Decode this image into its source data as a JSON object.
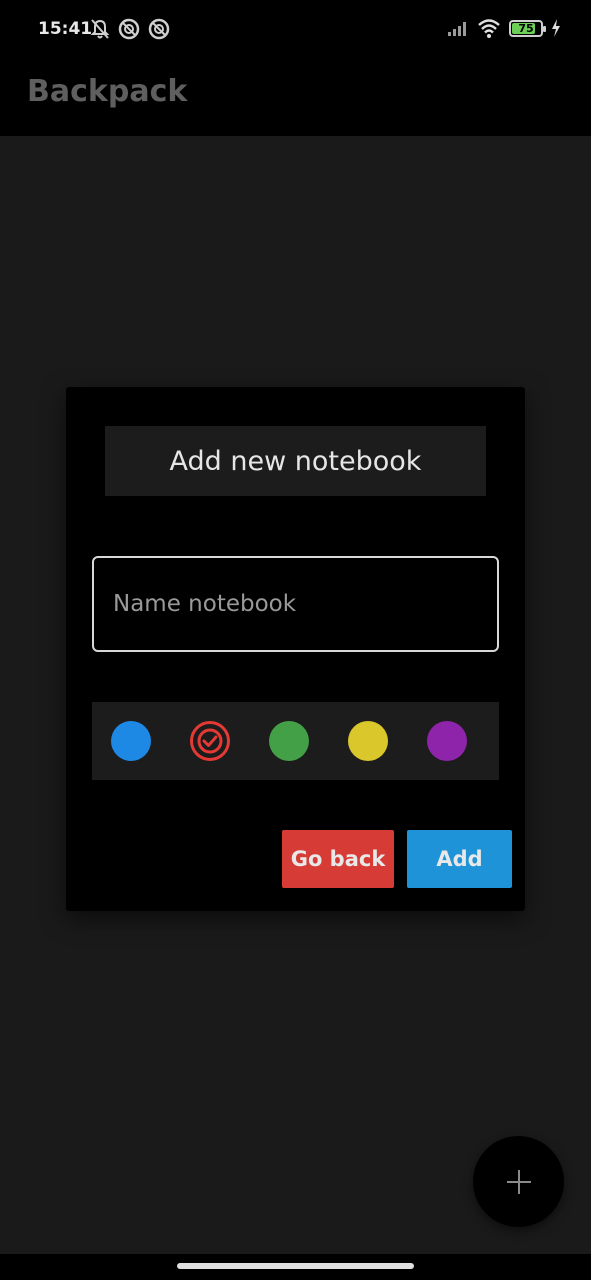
{
  "status_bar": {
    "time": "15:41",
    "battery_level": "75",
    "icons_left": [
      "bell-off-icon",
      "sync-icon",
      "sync-icon"
    ],
    "icons_right": [
      "signal-icon",
      "wifi-icon",
      "battery-icon",
      "charging-icon"
    ]
  },
  "app_bar": {
    "title": "Backpack"
  },
  "dialog": {
    "title": "Add new notebook",
    "name_input": {
      "value": "",
      "placeholder": "Name notebook"
    },
    "colors": [
      {
        "name": "blue",
        "hex": "#1e88e5",
        "selected": false
      },
      {
        "name": "red",
        "hex": "#e53935",
        "selected": true
      },
      {
        "name": "green",
        "hex": "#43a047",
        "selected": false
      },
      {
        "name": "yellow",
        "hex": "#d9c72c",
        "selected": false
      },
      {
        "name": "purple",
        "hex": "#8e24aa",
        "selected": false
      }
    ],
    "buttons": {
      "go_back_label": "Go back",
      "add_label": "Add"
    },
    "button_colors": {
      "go_back": "#d63c35",
      "add": "#1e93d8"
    }
  },
  "fab": {
    "icon": "plus-icon"
  }
}
